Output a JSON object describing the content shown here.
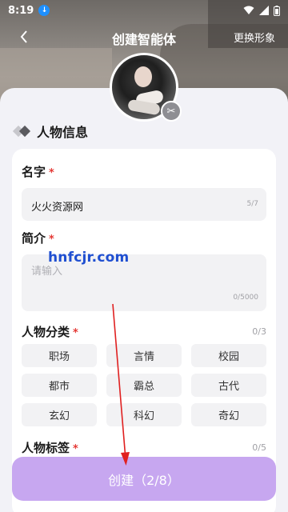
{
  "status_bar": {
    "time": "8:19"
  },
  "nav": {
    "title": "创建智能体",
    "change_look": "更换形象"
  },
  "section": {
    "title": "人物信息"
  },
  "form": {
    "name": {
      "label": "名字",
      "required": "*",
      "value": "火火资源网",
      "counter": "5/7"
    },
    "intro": {
      "label": "简介",
      "required": "*",
      "placeholder": "请输入",
      "counter": "0/5000"
    },
    "category": {
      "label": "人物分类",
      "required": "*",
      "counter": "0/3",
      "options": [
        "职场",
        "言情",
        "校园",
        "都市",
        "霸总",
        "古代",
        "玄幻",
        "科幻",
        "奇幻"
      ]
    },
    "tags": {
      "label": "人物标签",
      "required": "*",
      "counter": "0/5"
    }
  },
  "watermark": "hnfcjr.com",
  "create_button": "创建（2/8）",
  "colors": {
    "button": "#c7a7f0",
    "required": "#e53935",
    "watermark": "#1f4fd1",
    "arrow": "#e02020"
  }
}
